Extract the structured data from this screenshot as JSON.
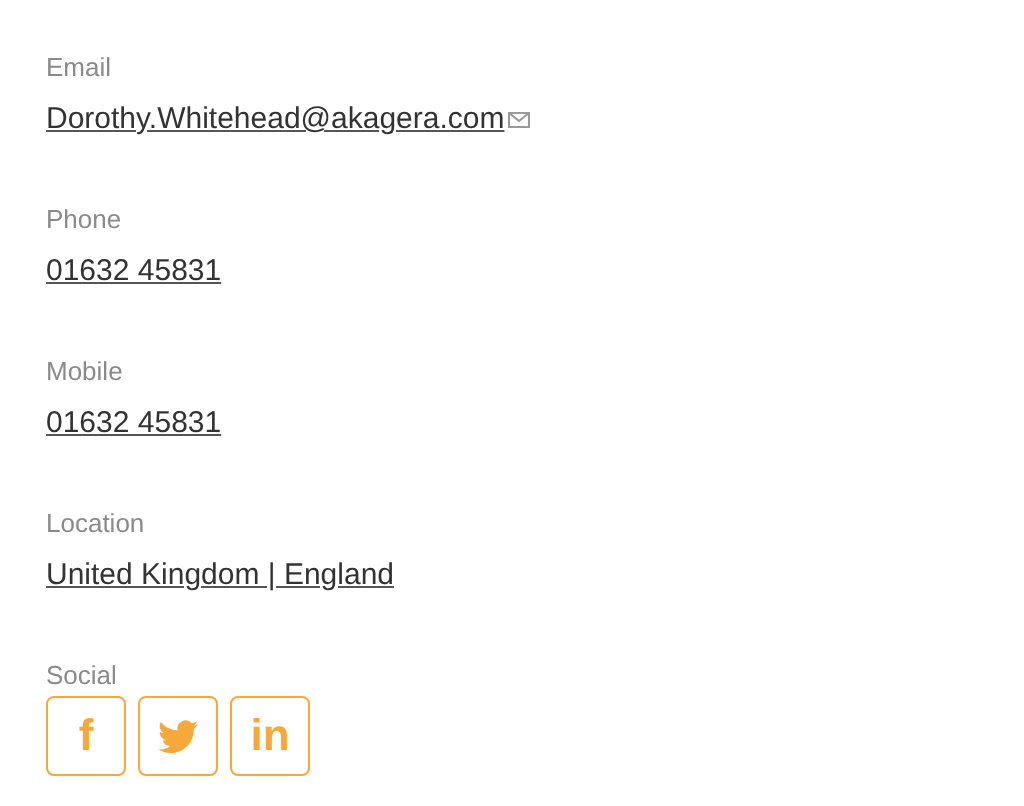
{
  "fields": [
    {
      "label": "Email",
      "value": "Dorothy.Whitehead@akagera.com",
      "kind": "email"
    },
    {
      "label": "Phone",
      "value": "01632 45831",
      "kind": "plain"
    },
    {
      "label": "Mobile",
      "value": "01632 45831",
      "kind": "plain"
    },
    {
      "label": "Location",
      "value": "United Kingdom | England",
      "kind": "plain"
    }
  ],
  "social": {
    "label": "Social",
    "buttons": [
      {
        "kind": "glyph",
        "glyph": "f"
      },
      {
        "kind": "bird"
      },
      {
        "kind": "glyph",
        "glyph": "in"
      }
    ]
  }
}
